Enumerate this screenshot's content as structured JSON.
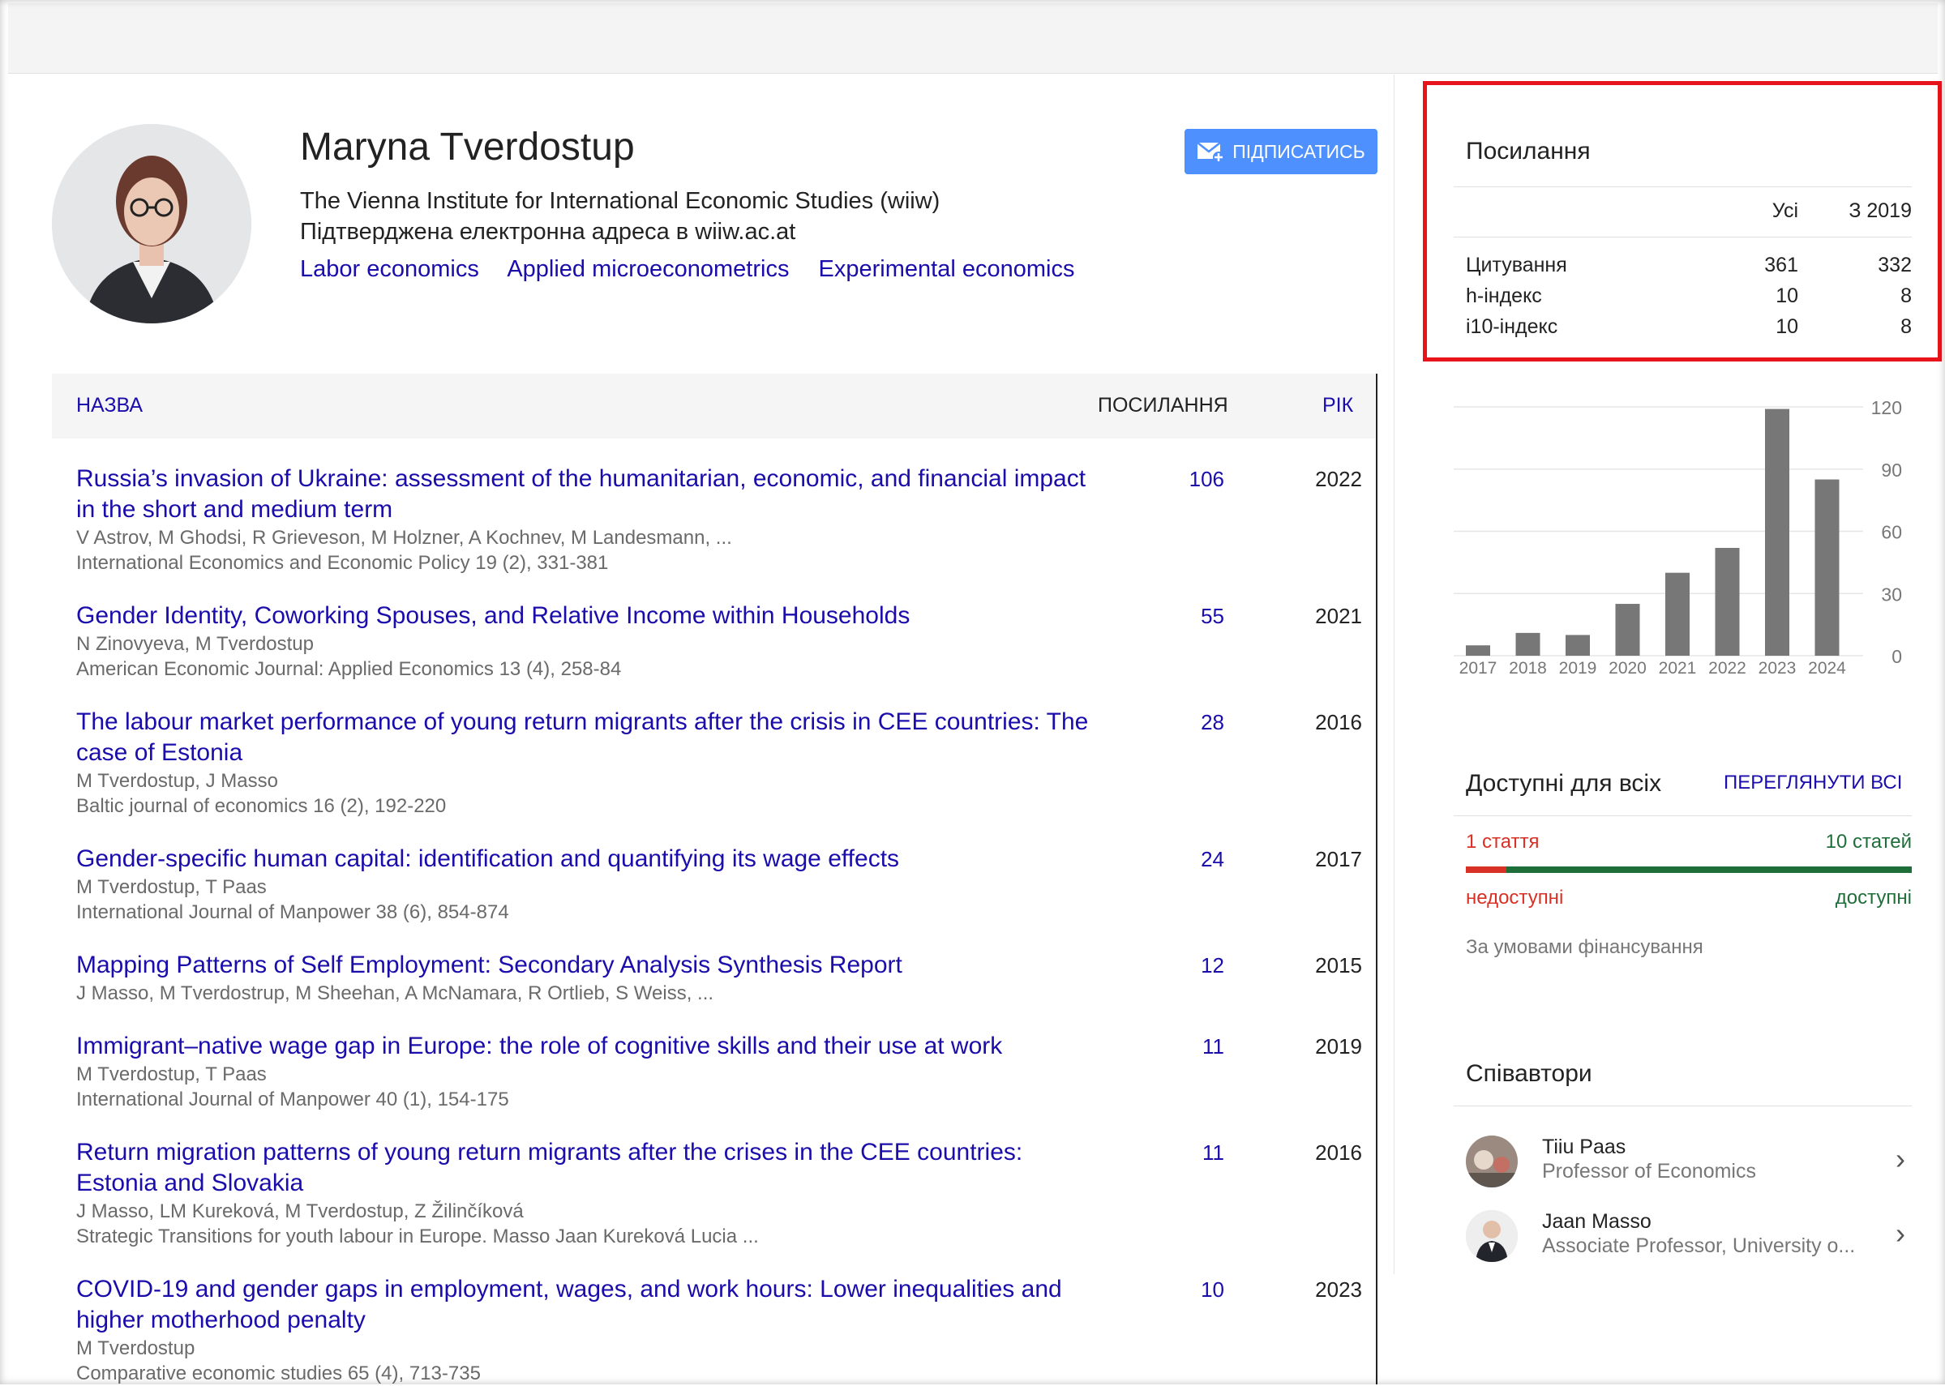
{
  "profile": {
    "name": "Maryna Tverdostup",
    "affiliation": "The Vienna Institute for International Economic Studies (wiiw)",
    "email_verified": "Підтверджена електронна адреса в wiiw.ac.at",
    "interests": [
      "Labor economics",
      "Applied microeconometrics",
      "Experimental economics"
    ],
    "follow_label": "ПІДПИСАТИСЬ"
  },
  "table": {
    "col_title": "НАЗВА",
    "col_cited": "ПОСИЛАННЯ",
    "col_year": "РІК",
    "rows": [
      {
        "title_1": "Russia’s invasion of Ukraine: assessment of the humanitarian, economic, and financial impact",
        "title_2": "in the short and medium term",
        "authors": "V Astrov, M Ghodsi, R Grieveson, M Holzner, A Kochnev, M Landesmann, ...",
        "venue": "International Economics and Economic Policy 19 (2), 331-381",
        "cites": "106",
        "year": "2022"
      },
      {
        "title_1": "Gender Identity, Coworking Spouses, and Relative Income within Households",
        "title_2": "",
        "authors": "N Zinovyeva, M Tverdostup",
        "venue": "American Economic Journal: Applied Economics 13 (4), 258-84",
        "cites": "55",
        "year": "2021"
      },
      {
        "title_1": "The labour market performance of young return migrants after the crisis in CEE countries: The",
        "title_2": "case of Estonia",
        "authors": "M Tverdostup, J Masso",
        "venue": "Baltic journal of economics 16 (2), 192-220",
        "cites": "28",
        "year": "2016"
      },
      {
        "title_1": "Gender-specific human capital: identification and quantifying its wage effects",
        "title_2": "",
        "authors": "M Tverdostup, T Paas",
        "venue": "International Journal of Manpower 38 (6), 854-874",
        "cites": "24",
        "year": "2017"
      },
      {
        "title_1": "Mapping Patterns of Self Employment: Secondary Analysis Synthesis Report",
        "title_2": "",
        "authors": "J Masso, M Tverdostrup, M Sheehan, A McNamara, R Ortlieb, S Weiss, ...",
        "venue": "",
        "cites": "12",
        "year": "2015"
      },
      {
        "title_1": "Immigrant–native wage gap in Europe: the role of cognitive skills and their use at work",
        "title_2": "",
        "authors": "M Tverdostup, T Paas",
        "venue": "International Journal of Manpower 40 (1), 154-175",
        "cites": "11",
        "year": "2019"
      },
      {
        "title_1": "Return migration patterns of young return migrants after the crises in the CEE countries:",
        "title_2": "Estonia and Slovakia",
        "authors": "J Masso, LM Kureková, M Tverdostup, Z Žilinčíková",
        "venue": "Strategic Transitions for youth labour in Europe. Masso Jaan Kureková Lucia ...",
        "cites": "11",
        "year": "2016"
      },
      {
        "title_1": "COVID-19 and gender gaps in employment, wages, and work hours: Lower inequalities and",
        "title_2": "higher motherhood penalty",
        "authors": "M Tverdostup",
        "venue": "Comparative economic studies 65 (4), 713-735",
        "cites": "10",
        "year": "2023"
      }
    ]
  },
  "citations": {
    "title": "Посилання",
    "col_all": "Усі",
    "col_since": "З 2019",
    "rows": [
      {
        "label": "Цитування",
        "all": "361",
        "since": "332"
      },
      {
        "label": "h-індекс",
        "all": "10",
        "since": "8"
      },
      {
        "label": "i10-індекс",
        "all": "10",
        "since": "8"
      }
    ]
  },
  "chart_data": {
    "type": "bar",
    "categories": [
      "2017",
      "2018",
      "2019",
      "2020",
      "2021",
      "2022",
      "2023",
      "2024"
    ],
    "values": [
      5,
      11,
      10,
      25,
      40,
      52,
      119,
      85
    ],
    "ylim": [
      0,
      120
    ],
    "yticks": [
      "0",
      "30",
      "60",
      "90",
      "120"
    ],
    "bar_color": "#777777"
  },
  "open_access": {
    "title": "Доступні для всіх",
    "view_all": "ПЕРЕГЛЯНУТИ ВСІ",
    "unavailable_count": "1 стаття",
    "available_count": "10 статей",
    "unavailable_label": "недоступні",
    "available_label": "доступні",
    "mandates": "За умовами фінансування",
    "unavailable_color": "#d93025",
    "available_color": "#1e6e3a"
  },
  "coauthors": {
    "title": "Співавтори",
    "items": [
      {
        "name": "Tiiu Paas",
        "affiliation": "Professor of Economics"
      },
      {
        "name": "Jaan Masso",
        "affiliation": "Associate Professor, University o..."
      }
    ]
  }
}
